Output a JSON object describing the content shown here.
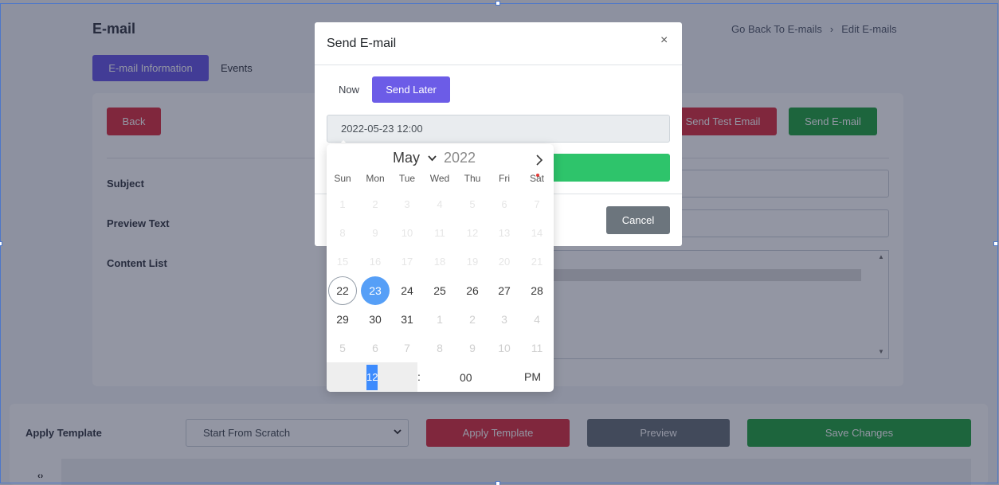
{
  "header": {
    "title": "E-mail",
    "breadcrumb": [
      "Go Back To E-mails",
      "Edit E-mails"
    ]
  },
  "tabs": [
    "E-mail Information",
    "Events"
  ],
  "actions": {
    "back": "Back",
    "send_test": "Send Test Email",
    "send": "Send E-mail"
  },
  "form": {
    "subject_label": "Subject",
    "preview_label": "Preview Text",
    "content_label": "Content List"
  },
  "template": {
    "label": "Apply Template",
    "selected": "Start From Scratch",
    "apply": "Apply Template",
    "preview": "Preview",
    "save": "Save Changes",
    "code_toggle": "‹›"
  },
  "modal": {
    "title": "Send E-mail",
    "close": "×",
    "now": "Now",
    "later": "Send Later",
    "datetime": "2022-05-23 12:00",
    "cancel": "Cancel"
  },
  "picker": {
    "month": "May",
    "year": "2022",
    "weekdays": [
      "Sun",
      "Mon",
      "Tue",
      "Wed",
      "Thu",
      "Fri",
      "Sat"
    ],
    "weeks": [
      [
        "1",
        "2",
        "3",
        "4",
        "5",
        "6",
        "7"
      ],
      [
        "8",
        "9",
        "10",
        "11",
        "12",
        "13",
        "14"
      ],
      [
        "15",
        "16",
        "17",
        "18",
        "19",
        "20",
        "21"
      ],
      [
        "22",
        "23",
        "24",
        "25",
        "26",
        "27",
        "28"
      ],
      [
        "29",
        "30",
        "31",
        "1",
        "2",
        "3",
        "4"
      ],
      [
        "5",
        "6",
        "7",
        "8",
        "9",
        "10",
        "11"
      ]
    ],
    "today": "22",
    "selected": "23",
    "hour": "12",
    "colon": ":",
    "minute": "00",
    "ampm": "PM"
  },
  "colors": {
    "accent": "#6c5ce7",
    "danger": "#dc3545",
    "success": "#28a745",
    "secondary": "#6c757d",
    "selected_day": "#569ff7"
  }
}
